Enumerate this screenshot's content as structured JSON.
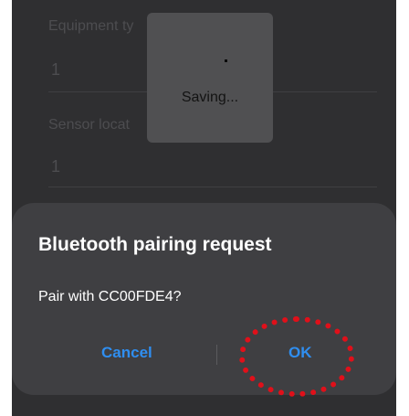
{
  "form": {
    "equipment_type_label": "Equipment ty",
    "equipment_type_value": "1",
    "sensor_location_label": "Sensor locat",
    "sensor_location_value": "1"
  },
  "toast": {
    "text": "Saving..."
  },
  "dialog": {
    "title": "Bluetooth pairing request",
    "message": "Pair with CC00FDE4?",
    "cancel_label": "Cancel",
    "ok_label": "OK"
  },
  "colors": {
    "background": "#2f2f31",
    "dialog_bg": "#3f3f42",
    "button_accent": "#2f8ef0",
    "highlight": "#e0101a"
  }
}
